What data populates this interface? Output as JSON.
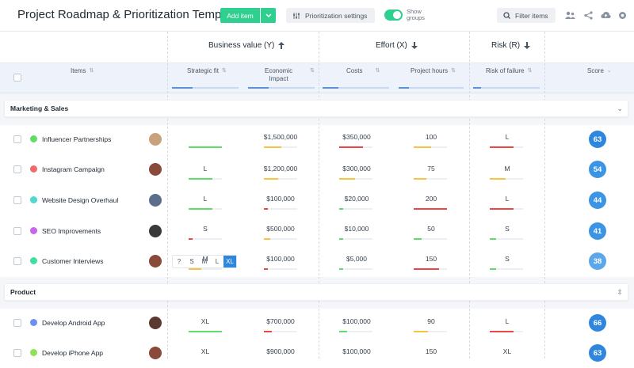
{
  "app": {
    "title": "Project Roadmap & Prioritization Template",
    "add_item_label": "Add item",
    "prioritization_label": "Prioritization settings",
    "show_groups_label_1": "Show",
    "show_groups_label_2": "groups",
    "filter_label": "Filter items",
    "accent": "#2ecf8f"
  },
  "groups": {
    "business": "Business value (Y)",
    "effort": "Effort (X)",
    "risk": "Risk (R)"
  },
  "columns": {
    "items": "Items",
    "strategic_fit": "Strategic fit",
    "economic_impact_1": "Economic",
    "economic_impact_2": "Impact",
    "costs": "Costs",
    "project_hours": "Project hours",
    "risk_of_failure": "Risk of failure",
    "score": "Score"
  },
  "size_picker": {
    "options": [
      "?",
      "S",
      "M",
      "L",
      "XL"
    ],
    "selected": "XL"
  },
  "sections": [
    {
      "label": "Marketing & Sales",
      "rows": [
        {
          "name": "Influencer Partnerships",
          "dot": "#5fdc6a",
          "fit": "",
          "impact": "$1,500,000",
          "costs": "$350,000",
          "hours": "100",
          "risk": "L",
          "score": "63",
          "score_color": "#2e86de"
        },
        {
          "name": "Instagram Campaign",
          "dot": "#ef6b6b",
          "fit": "L",
          "impact": "$1,200,000",
          "costs": "$300,000",
          "hours": "75",
          "risk": "M",
          "score": "54",
          "score_color": "#3b94e4"
        },
        {
          "name": "Website Design Overhaul",
          "dot": "#4fd8d0",
          "fit": "L",
          "impact": "$100,000",
          "costs": "$20,000",
          "hours": "200",
          "risk": "L",
          "score": "44",
          "score_color": "#3b94e4"
        },
        {
          "name": "SEO Improvements",
          "dot": "#c766e8",
          "fit": "S",
          "impact": "$500,000",
          "costs": "$10,000",
          "hours": "50",
          "risk": "S",
          "score": "41",
          "score_color": "#3b94e4"
        },
        {
          "name": "Customer Interviews",
          "dot": "#3ee0a0",
          "fit": "M",
          "impact": "$100,000",
          "costs": "$5,000",
          "hours": "150",
          "risk": "S",
          "score": "38",
          "score_color": "#5aa7ea"
        }
      ]
    },
    {
      "label": "Product",
      "rows": [
        {
          "name": "Develop Android App",
          "dot": "#6c8ff0",
          "fit": "XL",
          "impact": "$700,000",
          "costs": "$100,000",
          "hours": "90",
          "risk": "L",
          "score": "66",
          "score_color": "#2e86de"
        },
        {
          "name": "Develop iPhone App",
          "dot": "#8fe05a",
          "fit": "XL",
          "impact": "$900,000",
          "costs": "$100,000",
          "hours": "150",
          "risk": "XL",
          "score": "63",
          "score_color": "#2e86de"
        }
      ]
    }
  ]
}
